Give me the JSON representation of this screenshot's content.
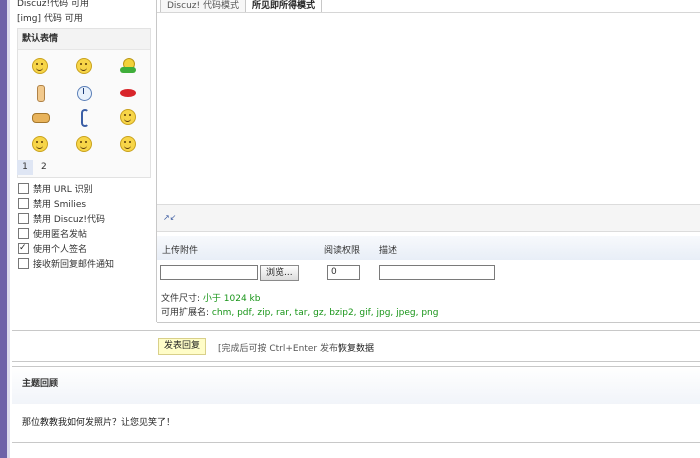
{
  "left": {
    "top_lines": [
      "Discuz!代码 可用",
      "[img] 代码 可用"
    ],
    "smilies_title": "默认表情",
    "pages": [
      "1",
      "2"
    ],
    "options": [
      {
        "label": "禁用 URL 识别",
        "checked": false
      },
      {
        "label": "禁用 Smilies",
        "checked": false
      },
      {
        "label": "禁用 Discuz!代码",
        "checked": false
      },
      {
        "label": "使用匿名发帖",
        "checked": false
      },
      {
        "label": "使用个人签名",
        "checked": true
      },
      {
        "label": "接收新回复邮件通知",
        "checked": false
      }
    ],
    "smilies_icons": [
      "smile-icon",
      "grin-icon",
      "huffy-icon",
      "victory-icon",
      "time-icon",
      "kiss-icon",
      "handshake-icon",
      "shy-icon",
      "wink-icon",
      "sweat-icon",
      "tongue-icon",
      "sad-icon"
    ]
  },
  "editor": {
    "tab_code": "Discuz! 代码模式",
    "tab_wysiwyg": "所见即所得模式",
    "resize_symbol": "↗↙"
  },
  "attach": {
    "col_file": "上传附件",
    "col_perm": "阅读权限",
    "col_desc": "描述",
    "browse_label": "浏览...",
    "perm_value": "0",
    "size_label": "文件尺寸:",
    "size_value": "小于 1024 kb",
    "ext_label": "可用扩展名:",
    "ext_value": "chm, pdf, zip, rar, tar, gz, bzip2, gif, jpg, jpeg, png"
  },
  "submit": {
    "button": "发表回复",
    "hint": "[完成后可按 Ctrl+Enter 发布]",
    "restore": "恢复数据"
  },
  "review": {
    "title": "主题回顾",
    "text": "那位教教我如何发照片？让您见笑了！"
  }
}
